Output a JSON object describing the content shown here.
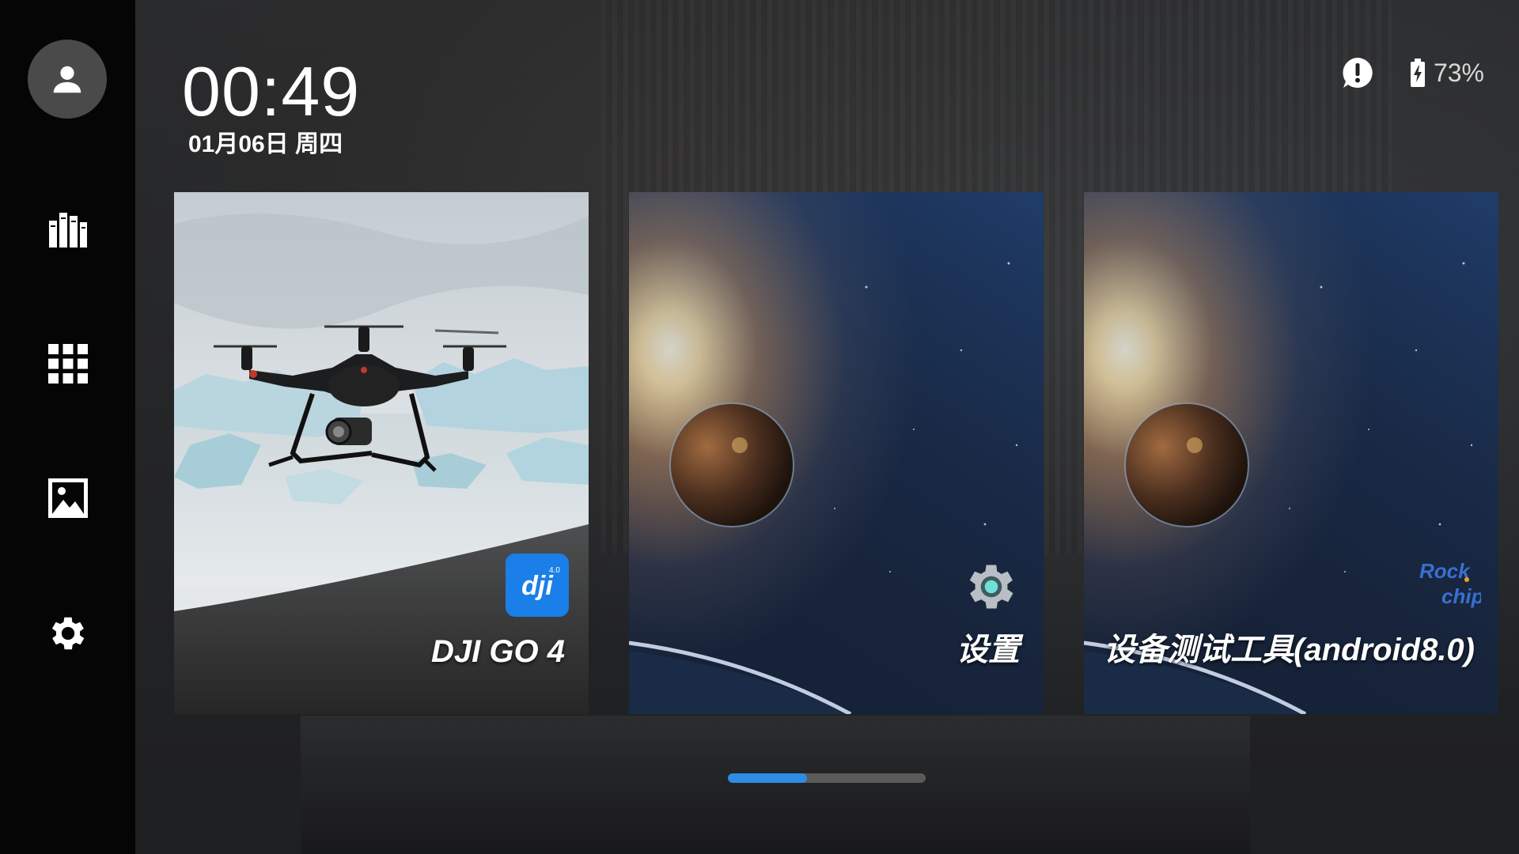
{
  "clock": {
    "time": "00:49",
    "date": "01月06日 周四"
  },
  "status": {
    "alert_icon": "alert-circle-icon",
    "battery_icon": "battery-charging-icon",
    "battery_text": "73%"
  },
  "sidebar": {
    "items": [
      {
        "icon": "user-avatar-icon"
      },
      {
        "icon": "library-books-icon"
      },
      {
        "icon": "apps-grid-icon"
      },
      {
        "icon": "gallery-image-icon"
      },
      {
        "icon": "settings-gear-icon"
      }
    ]
  },
  "cards": [
    {
      "label": "DJI GO 4",
      "badge_icon": "dji-go-app-icon",
      "badge_text": "dji"
    },
    {
      "label": "设置",
      "badge_icon": "settings-app-icon"
    },
    {
      "label": "设备测试工具(android8.0)",
      "badge_icon": "rockchip-logo-icon",
      "badge_text": "Rock chip"
    }
  ],
  "pager": {
    "current_fraction": 0.4,
    "active_color": "#2e8de2",
    "track_color": "#5a5a5a"
  }
}
